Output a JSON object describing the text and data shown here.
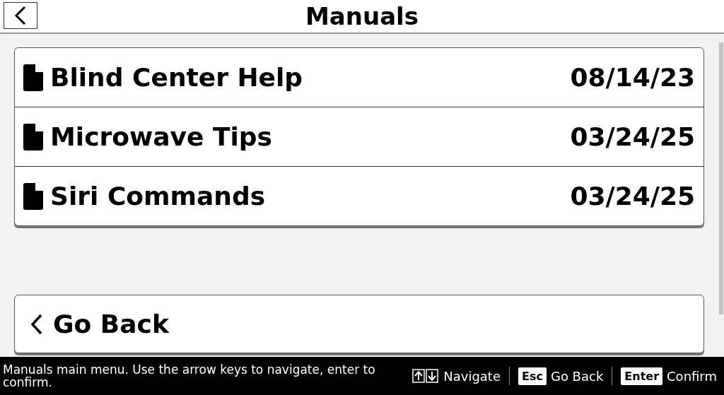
{
  "header": {
    "title": "Manuals"
  },
  "manuals": [
    {
      "name": "Blind Center Help",
      "date": "08/14/23"
    },
    {
      "name": "Microwave Tips",
      "date": "03/24/25"
    },
    {
      "name": "Siri Commands",
      "date": "03/24/25"
    }
  ],
  "go_back": {
    "label": "Go Back"
  },
  "footer": {
    "message": "Manuals main menu. Use the arrow keys to navigate, enter to confirm.",
    "hints": [
      {
        "kind": "arrows",
        "label": "Navigate"
      },
      {
        "kind": "key",
        "key": "Esc",
        "label": "Go Back"
      },
      {
        "kind": "key",
        "key": "Enter",
        "label": "Confirm"
      }
    ]
  }
}
